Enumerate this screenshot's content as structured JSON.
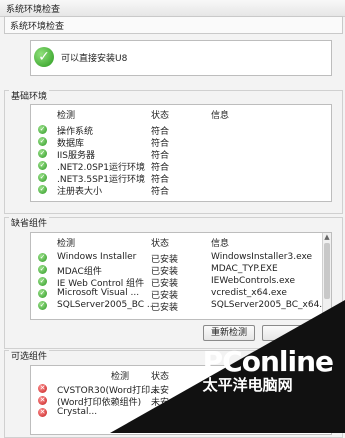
{
  "window": {
    "title": "系统环境检查"
  },
  "panel": {
    "title": "系统环境检查"
  },
  "result": {
    "text": "可以直接安装U8"
  },
  "basic": {
    "caption": "基础环境",
    "headers": [
      "检测",
      "状态",
      "信息"
    ],
    "rows": [
      {
        "name": "操作系统",
        "status": "符合",
        "info": ""
      },
      {
        "name": "数据库",
        "status": "符合",
        "info": ""
      },
      {
        "name": "IIS服务器",
        "status": "符合",
        "info": ""
      },
      {
        "name": ".NET2.0SP1运行环境",
        "status": "符合",
        "info": ""
      },
      {
        "name": ".NET3.5SP1运行环境",
        "status": "符合",
        "info": ""
      },
      {
        "name": "注册表大小",
        "status": "符合",
        "info": ""
      }
    ]
  },
  "default_components": {
    "caption": "缺省组件",
    "headers": [
      "检测",
      "状态",
      "信息"
    ],
    "rows": [
      {
        "name": "Windows Installer",
        "status": "已安装",
        "info": "WindowsInstaller3.exe"
      },
      {
        "name": "MDAC组件",
        "status": "已安装",
        "info": "MDAC_TYP.EXE"
      },
      {
        "name": "IE Web Control 组件",
        "status": "已安装",
        "info": "IEWebControls.exe"
      },
      {
        "name": "Microsoft Visual ...",
        "status": "已安装",
        "info": "vcredist_x64.exe"
      },
      {
        "name": "SQLServer2005_BC ...",
        "status": "已安装",
        "info": "SQLServer2005_BC_x64..."
      }
    ],
    "button_label": "重新检测"
  },
  "optional_components": {
    "caption": "可选组件",
    "headers": [
      "检测",
      "状态"
    ],
    "rows": [
      {
        "name": "CVSTOR30(Word打印...",
        "status": "未安"
      },
      {
        "name": "(Word打印依赖组件)",
        "status": "未安"
      },
      {
        "name": "Crystal...",
        "status": "未安"
      }
    ]
  },
  "watermark": {
    "brand": "PConline",
    "cn": "太平洋电脑网"
  }
}
